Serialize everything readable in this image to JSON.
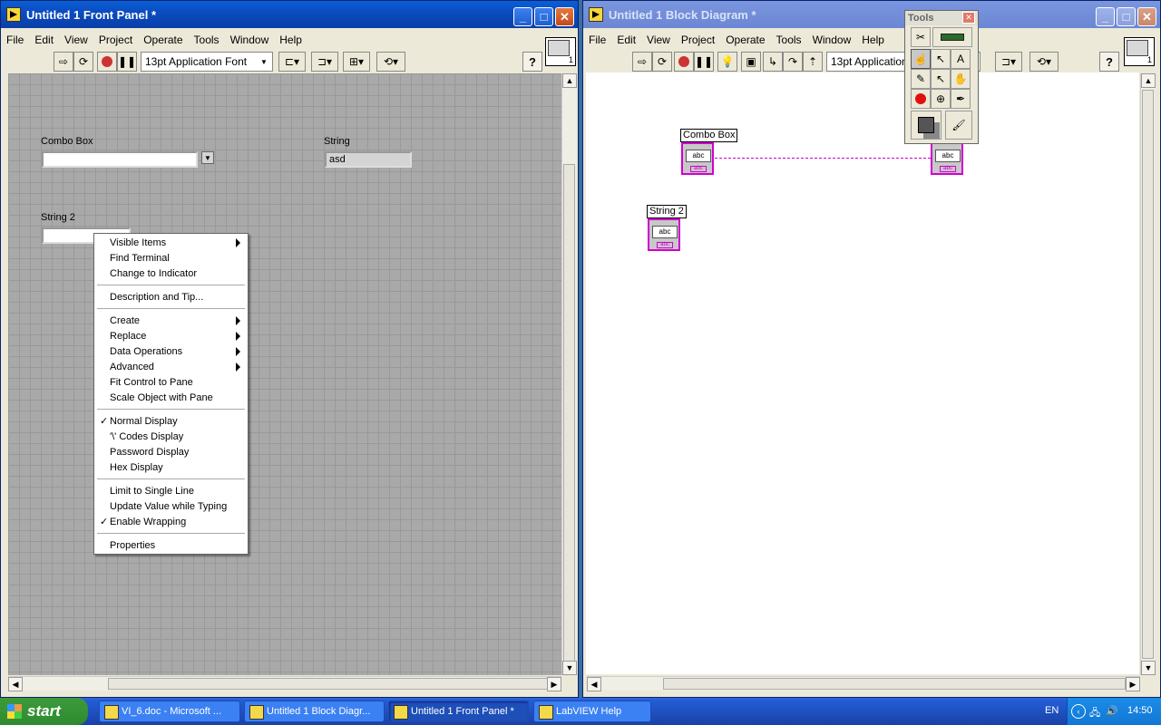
{
  "front_panel": {
    "title": "Untitled 1 Front Panel *",
    "menu": [
      "File",
      "Edit",
      "View",
      "Project",
      "Operate",
      "Tools",
      "Window",
      "Help"
    ],
    "font_select": "13pt Application Font",
    "controls": {
      "combo_label": "Combo Box",
      "combo_value": "",
      "string_label": "String",
      "string_value": "asd",
      "string2_label": "String 2",
      "string2_value": ""
    }
  },
  "context_menu": {
    "items": [
      {
        "label": "Visible Items",
        "submenu": true,
        "checked": false
      },
      {
        "label": "Find Terminal",
        "submenu": false,
        "checked": false
      },
      {
        "label": "Change to Indicator",
        "submenu": false,
        "checked": false
      },
      {
        "label": "Description and Tip...",
        "submenu": false,
        "checked": false
      },
      {
        "label": "Create",
        "submenu": true,
        "checked": false
      },
      {
        "label": "Replace",
        "submenu": true,
        "checked": false
      },
      {
        "label": "Data Operations",
        "submenu": true,
        "checked": false
      },
      {
        "label": "Advanced",
        "submenu": true,
        "checked": false
      },
      {
        "label": "Fit Control to Pane",
        "submenu": false,
        "checked": false
      },
      {
        "label": "Scale Object with Pane",
        "submenu": false,
        "checked": false
      },
      {
        "label": "Normal Display",
        "submenu": false,
        "checked": true
      },
      {
        "label": "'\\' Codes Display",
        "submenu": false,
        "checked": false
      },
      {
        "label": "Password Display",
        "submenu": false,
        "checked": false
      },
      {
        "label": "Hex Display",
        "submenu": false,
        "checked": false
      },
      {
        "label": "Limit to Single Line",
        "submenu": false,
        "checked": false
      },
      {
        "label": "Update Value while Typing",
        "submenu": false,
        "checked": false
      },
      {
        "label": "Enable Wrapping",
        "submenu": false,
        "checked": true
      },
      {
        "label": "Properties",
        "submenu": false,
        "checked": false
      }
    ]
  },
  "block_diagram": {
    "title": "Untitled 1 Block Diagram *",
    "menu": [
      "File",
      "Edit",
      "View",
      "Project",
      "Operate",
      "Tools",
      "Window",
      "Help"
    ],
    "font_select": "13pt Application I",
    "terminals": {
      "combo_label": "Combo Box",
      "combo_text": "abc",
      "string_text": "abc",
      "string2_label": "String 2",
      "string2_text": "abc",
      "sub_text": "abc"
    },
    "wire_color": "#d000d0"
  },
  "tools_palette": {
    "title": "Tools"
  },
  "taskbar": {
    "start_label": "start",
    "tasks": [
      {
        "label": "VI_6.doc - Microsoft ...",
        "active": false
      },
      {
        "label": "Untitled 1 Block Diagr...",
        "active": false
      },
      {
        "label": "Untitled 1 Front Panel *",
        "active": true
      },
      {
        "label": "LabVIEW Help",
        "active": false
      }
    ],
    "lang": "EN",
    "clock": "14:50"
  },
  "colors": {
    "titlebar_active": "#0a5fd8",
    "panel_grid": "#a9a9a9",
    "wire": "#d000d0"
  }
}
